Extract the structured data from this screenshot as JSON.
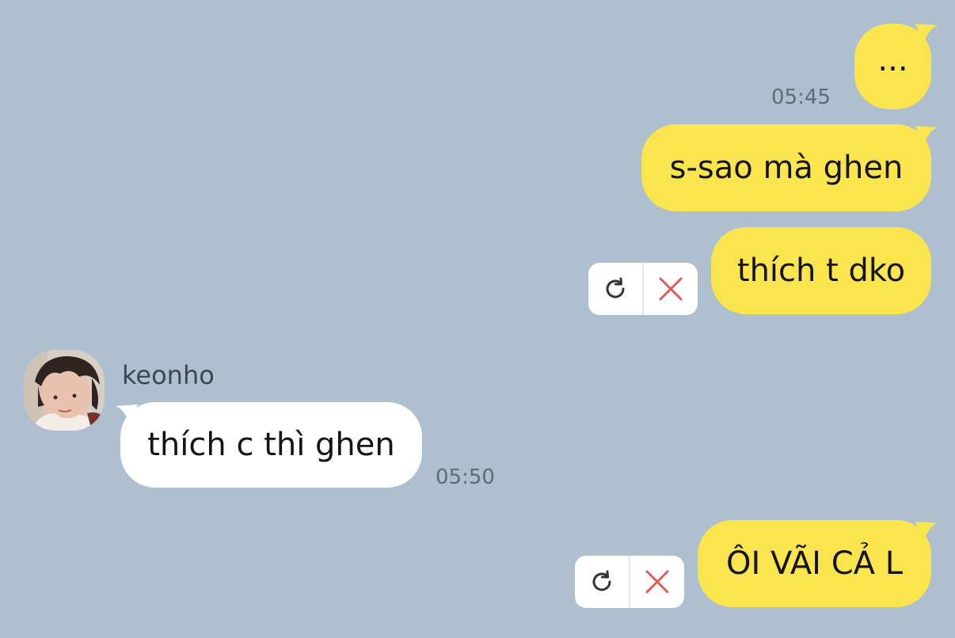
{
  "messages": {
    "m1": {
      "text": "...",
      "time": "05:45"
    },
    "m2": {
      "text": "s-sao mà ghen"
    },
    "m3": {
      "text": "thích t dko"
    },
    "m4": {
      "sender": "keonho",
      "text": "thích c thì ghen",
      "time": "05:50"
    },
    "m5": {
      "text": "ÔI VÃI CẢ L"
    }
  },
  "icons": {
    "retry": "refresh-icon",
    "cancel": "close-icon"
  },
  "colors": {
    "background": "#aebfcf",
    "outgoing_bubble": "#fbe54f",
    "incoming_bubble": "#ffffff",
    "cancel_x": "#e05a5a"
  }
}
